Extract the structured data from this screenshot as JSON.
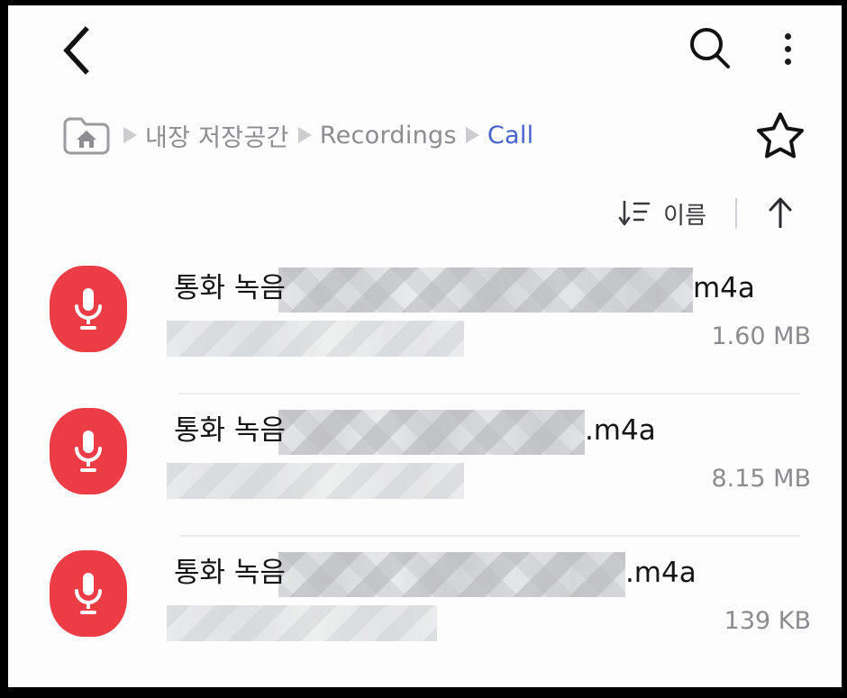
{
  "appbar": {
    "back_icon": "chevron-left-icon",
    "search_icon": "search-icon",
    "overflow_icon": "more-vertical-icon"
  },
  "breadcrumb": {
    "home_icon": "home-folder-icon",
    "separator_icon": "triangle-right-icon",
    "items": [
      {
        "label": "내장 저장공간",
        "current": false
      },
      {
        "label": "Recordings",
        "current": false
      },
      {
        "label": "Call",
        "current": true
      }
    ],
    "favorite_icon": "star-outline-icon",
    "current_color": "#4663cf"
  },
  "sort_bar": {
    "sort_icon": "sort-descending-icon",
    "sort_label": "이름",
    "direction_icon": "arrow-up-icon"
  },
  "files": [
    {
      "icon": "microphone-icon",
      "icon_color": "#ec3c45",
      "name_prefix": "통화 녹음",
      "extension": "m4a",
      "size": "1.60 MB",
      "redacted": true,
      "redact_width": 460,
      "sub_redact_width": 330
    },
    {
      "icon": "microphone-icon",
      "icon_color": "#ec3c45",
      "name_prefix": "통화 녹음",
      "extension": ".m4a",
      "size": "8.15 MB",
      "redacted": true,
      "redact_width": 340,
      "sub_redact_width": 330
    },
    {
      "icon": "microphone-icon",
      "icon_color": "#ec3c45",
      "name_prefix": "통화 녹음",
      "extension": ".m4a",
      "size": "139 KB",
      "redacted": true,
      "redact_width": 385,
      "sub_redact_width": 300
    }
  ]
}
